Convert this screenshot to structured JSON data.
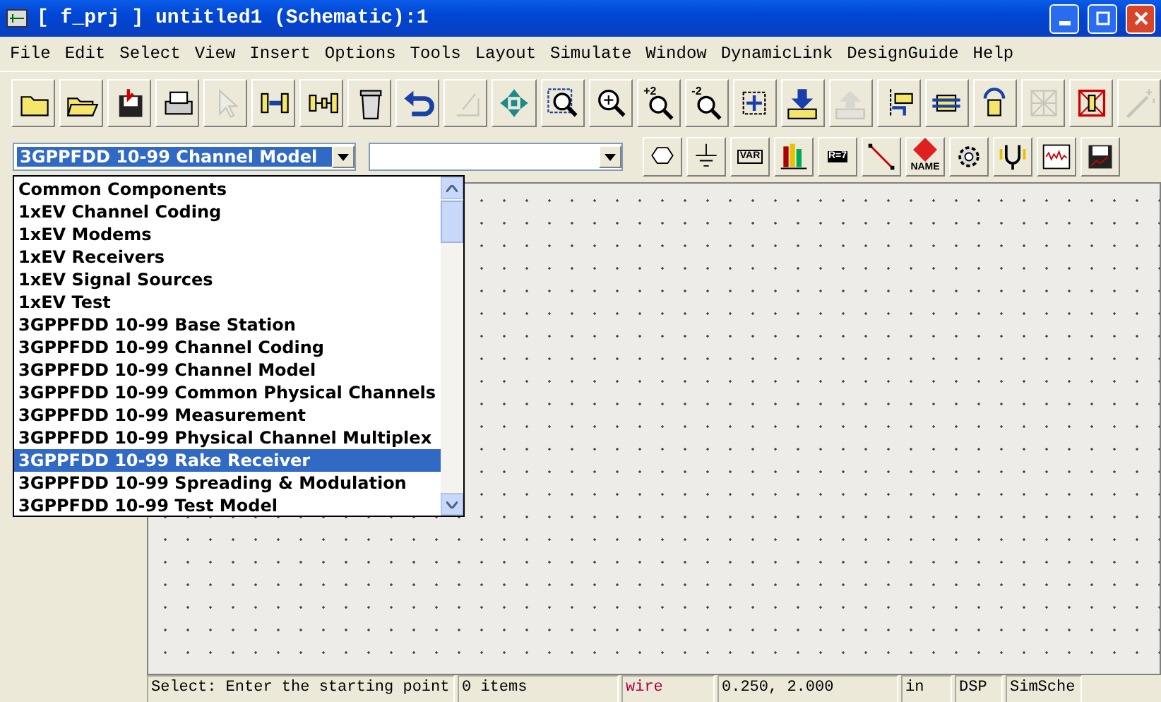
{
  "window": {
    "title": "[ f_prj ] untitled1 (Schematic):1"
  },
  "menu": [
    "File",
    "Edit",
    "Select",
    "View",
    "Insert",
    "Options",
    "Tools",
    "Layout",
    "Simulate",
    "Window",
    "DynamicLink",
    "DesignGuide",
    "Help"
  ],
  "toolbar": [
    {
      "kind": "new",
      "disabled": false
    },
    {
      "kind": "open",
      "disabled": false
    },
    {
      "kind": "save",
      "disabled": false
    },
    {
      "kind": "print",
      "disabled": false
    },
    {
      "kind": "pointer",
      "disabled": true
    },
    {
      "kind": "insert",
      "disabled": false
    },
    {
      "kind": "insert2",
      "disabled": false
    },
    {
      "kind": "delete",
      "disabled": false
    },
    {
      "kind": "undo",
      "disabled": false
    },
    {
      "kind": "redo",
      "disabled": true
    },
    {
      "kind": "move",
      "disabled": false
    },
    {
      "kind": "zoomarea",
      "disabled": false
    },
    {
      "kind": "zoomin",
      "disabled": false
    },
    {
      "kind": "zoomlabel",
      "label": "+2",
      "disabled": false
    },
    {
      "kind": "zoomlabel",
      "label": "-2",
      "disabled": false
    },
    {
      "kind": "fit",
      "disabled": false
    },
    {
      "kind": "push",
      "disabled": false
    },
    {
      "kind": "pop",
      "disabled": true
    },
    {
      "kind": "comp",
      "disabled": false
    },
    {
      "kind": "comp2",
      "disabled": false
    },
    {
      "kind": "comp3",
      "disabled": false
    },
    {
      "kind": "grid",
      "disabled": true
    },
    {
      "kind": "boxx",
      "disabled": false
    },
    {
      "kind": "wand",
      "disabled": true
    }
  ],
  "library_combo": {
    "value": "3GPPFDD 10-99 Channel Model"
  },
  "palette": [
    {
      "kind": "port"
    },
    {
      "kind": "ground"
    },
    {
      "kind": "var",
      "label": "VAR"
    },
    {
      "kind": "books"
    },
    {
      "kind": "chart",
      "label": "R=7"
    },
    {
      "kind": "wire"
    },
    {
      "kind": "name",
      "label": "NAME"
    },
    {
      "kind": "gear"
    },
    {
      "kind": "fork"
    },
    {
      "kind": "wave"
    },
    {
      "kind": "savechart"
    }
  ],
  "library_list": [
    {
      "label": "Common Components",
      "selected": false
    },
    {
      "label": "1xEV Channel Coding",
      "selected": false
    },
    {
      "label": "1xEV Modems",
      "selected": false
    },
    {
      "label": "1xEV Receivers",
      "selected": false
    },
    {
      "label": "1xEV Signal Sources",
      "selected": false
    },
    {
      "label": "1xEV Test",
      "selected": false
    },
    {
      "label": "3GPPFDD 10-99 Base Station",
      "selected": false
    },
    {
      "label": "3GPPFDD 10-99 Channel Coding",
      "selected": false
    },
    {
      "label": "3GPPFDD 10-99 Channel Model",
      "selected": false
    },
    {
      "label": "3GPPFDD 10-99 Common Physical Channels",
      "selected": false
    },
    {
      "label": "3GPPFDD 10-99 Measurement",
      "selected": false
    },
    {
      "label": "3GPPFDD 10-99 Physical Channel Multiplex",
      "selected": false
    },
    {
      "label": "3GPPFDD 10-99 Rake Receiver",
      "selected": true
    },
    {
      "label": "3GPPFDD 10-99 Spreading & Modulation",
      "selected": false
    },
    {
      "label": "3GPPFDD 10-99 Test Model",
      "selected": false
    }
  ],
  "status_bar": [
    {
      "text": "Select: Enter the starting point",
      "kind": "plain"
    },
    {
      "text": "0 items",
      "kind": "plain"
    },
    {
      "text": "wire",
      "kind": "accent"
    },
    {
      "text": "0.250, 2.000",
      "kind": "plain"
    },
    {
      "text": "in",
      "kind": "plain"
    },
    {
      "text": "DSP",
      "kind": "plain"
    },
    {
      "text": "SimSche",
      "kind": "plain"
    }
  ]
}
